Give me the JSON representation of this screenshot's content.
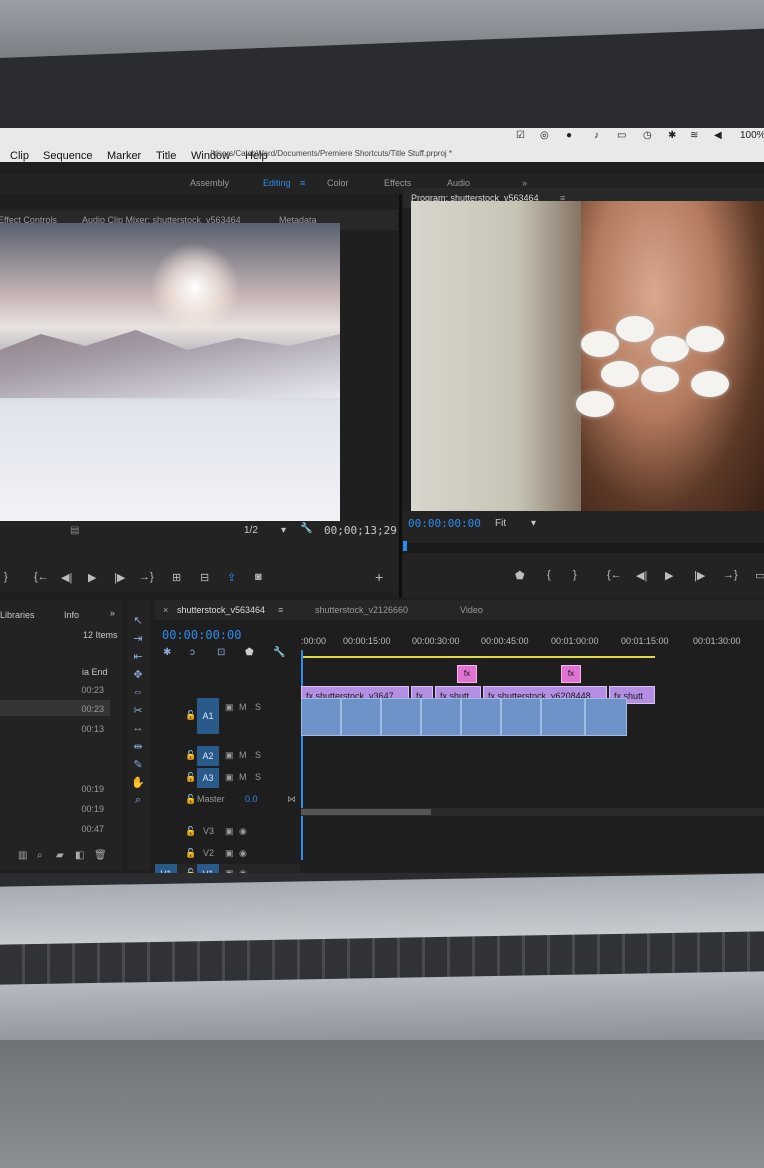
{
  "menubar": {
    "items": [
      "Clip",
      "Sequence",
      "Marker",
      "Title",
      "Window",
      "Help"
    ],
    "path": "/Users/CalebWard/Documents/Premiere Shortcuts/Title Stuff.prproj *",
    "battery": "100%"
  },
  "workspaces": {
    "tabs": [
      "Assembly",
      "Editing",
      "Color",
      "Effects",
      "Audio"
    ],
    "active": "Editing",
    "more": "»"
  },
  "source_panel": {
    "tabs": [
      "Effect Controls",
      "Audio Clip Mixer: shutterstock_v563464",
      "Metadata"
    ],
    "resolution": "1/2",
    "timecode": "00;00;13;29"
  },
  "program_panel": {
    "title": "Program: shutterstock_v563464",
    "timecode": "00:00:00:00",
    "fit": "Fit"
  },
  "project_panel": {
    "tabs": [
      "Libraries",
      "Info"
    ],
    "count": "12 Items",
    "column": "ia End",
    "values": [
      "00:23",
      "00:23",
      "00:13",
      "00:19",
      "00:19",
      "00:47"
    ]
  },
  "timeline": {
    "tabs": [
      "shutterstock_v563464",
      "shutterstock_v2126660",
      "Video"
    ],
    "timecode": "00:00:00:00",
    "ruler": [
      ":00:00",
      "00:00:15:00",
      "00:00:30:00",
      "00:00:45:00",
      "00:01:00:00",
      "00:01:15:00",
      "00:01:30:00"
    ],
    "tracks": {
      "v3": "V3",
      "v2": "V2",
      "v1": "V1",
      "src_v1": "V1",
      "a1": "A1",
      "a2": "A2",
      "a3": "A3",
      "master": "Master",
      "master_val": "0.0",
      "m": "M",
      "s": "S"
    },
    "clips": [
      "shutterstock_v3647",
      "shutt",
      "shutterstock_v6208448",
      "shutt"
    ],
    "fx": "fx"
  },
  "colors": {
    "accent_blue": "#2d8ceb",
    "clip_purple": "#b48ee3",
    "clip_audio": "#6d93c8",
    "fx_pink": "#e073d2"
  }
}
